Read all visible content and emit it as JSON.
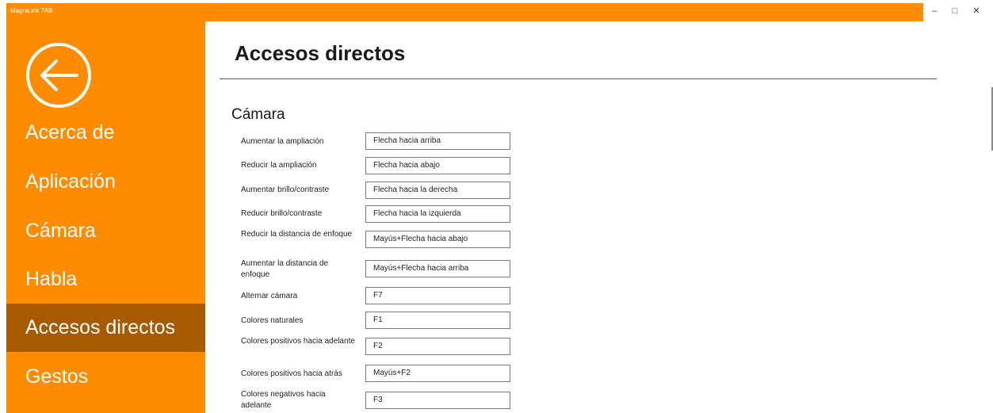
{
  "window": {
    "title": "MagniLink TAB",
    "controls": {
      "minimize": "–",
      "maximize": "□",
      "close": "✕"
    }
  },
  "sidebar": {
    "back_icon": "back-arrow-icon",
    "items": [
      {
        "label": "Acerca de",
        "active": false
      },
      {
        "label": "Aplicación",
        "active": false
      },
      {
        "label": "Cámara",
        "active": false
      },
      {
        "label": "Habla",
        "active": false
      },
      {
        "label": "Accesos directos",
        "active": true
      },
      {
        "label": "Gestos",
        "active": false
      }
    ]
  },
  "main": {
    "title": "Accesos directos",
    "section": "Cámara",
    "shortcuts": [
      {
        "label": "Aumentar la ampliación",
        "value": "Flecha hacia arriba"
      },
      {
        "label": "Reducir la ampliación",
        "value": "Flecha hacia abajo"
      },
      {
        "label": "Aumentar brillo/contraste",
        "value": "Flecha hacia la derecha"
      },
      {
        "label": "Reducir brillo/contraste",
        "value": "Flecha hacia la izquierda"
      },
      {
        "label": "Reducir la distancia de enfoque",
        "value": "Mayús+Flecha hacia abajo"
      },
      {
        "label": "Aumentar la distancia de enfoque",
        "value": "Mayús+Flecha hacia arriba"
      },
      {
        "label": "Alternar cámara",
        "value": "F7"
      },
      {
        "label": "Colores naturales",
        "value": "F1"
      },
      {
        "label": "Colores positivos hacia adelante",
        "value": "F2"
      },
      {
        "label": "Colores positivos hacia atrás",
        "value": "Mayús+F2"
      },
      {
        "label": "Colores negativos hacia adelante",
        "value": "F3"
      }
    ]
  },
  "colors": {
    "accent": "#ff8c00",
    "active_nav": "#a85a00",
    "text": "#1a1a1a"
  }
}
